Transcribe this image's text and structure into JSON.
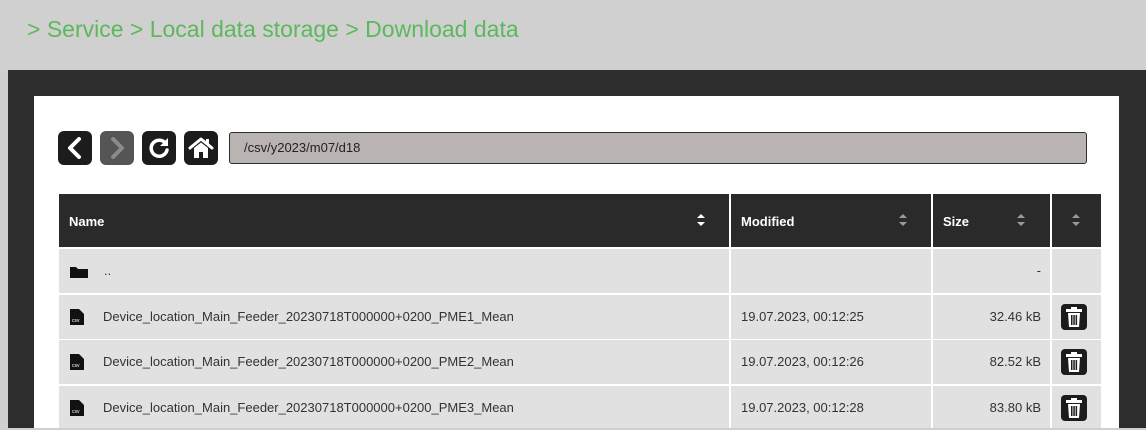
{
  "breadcrumb": "> Service > Local data storage > Download data",
  "path": "/csv/y2023/m07/d18",
  "table": {
    "headers": {
      "name": "Name",
      "modified": "Modified",
      "size": "Size"
    },
    "parent_row": {
      "name": "..",
      "modified": "",
      "size": "-"
    },
    "rows": [
      {
        "name": "Device_location_Main_Feeder_20230718T000000+0200_PME1_Mean",
        "modified": "19.07.2023, 00:12:25",
        "size": "32.46 kB"
      },
      {
        "name": "Device_location_Main_Feeder_20230718T000000+0200_PME2_Mean",
        "modified": "19.07.2023, 00:12:26",
        "size": "82.52 kB"
      },
      {
        "name": "Device_location_Main_Feeder_20230718T000000+0200_PME3_Mean",
        "modified": "19.07.2023, 00:12:28",
        "size": "83.80 kB"
      }
    ]
  },
  "icons": {
    "back": "chevron-left-icon",
    "forward": "chevron-right-icon",
    "refresh": "refresh-icon",
    "home": "home-icon",
    "folder": "folder-icon",
    "file": "csv-file-icon",
    "delete": "trash-icon"
  },
  "colors": {
    "accent": "#5cb85c",
    "header_bg": "#2a2a2a",
    "row_bg": "#e1e1e1",
    "path_bg": "#b9b3b1"
  }
}
